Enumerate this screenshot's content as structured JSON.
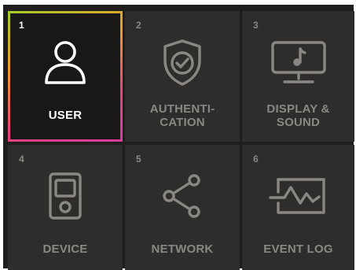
{
  "menu": {
    "tiles": [
      {
        "number": "1",
        "label_lines": [
          "USER"
        ],
        "icon": "user-icon",
        "selected": true
      },
      {
        "number": "2",
        "label_lines": [
          "AUTHENTI-",
          "CATION"
        ],
        "icon": "shield-check-icon",
        "selected": false
      },
      {
        "number": "3",
        "label_lines": [
          "DISPLAY &",
          "SOUND"
        ],
        "icon": "monitor-music-icon",
        "selected": false
      },
      {
        "number": "4",
        "label_lines": [
          "DEVICE"
        ],
        "icon": "device-icon",
        "selected": false
      },
      {
        "number": "5",
        "label_lines": [
          "NETWORK"
        ],
        "icon": "share-network-icon",
        "selected": false
      },
      {
        "number": "6",
        "label_lines": [
          "EVENT LOG"
        ],
        "icon": "event-log-icon",
        "selected": false
      }
    ]
  },
  "colors": {
    "panel_background": "#1f1e1c",
    "tile_background": "#2f2d2b",
    "selected_tile_background": "#191817",
    "inactive_text": "#8a8783",
    "active_text": "#ffffff",
    "selection_gradient": [
      "#a8cc2a",
      "#f09a2a",
      "#e8447a",
      "#d83aa0"
    ]
  }
}
